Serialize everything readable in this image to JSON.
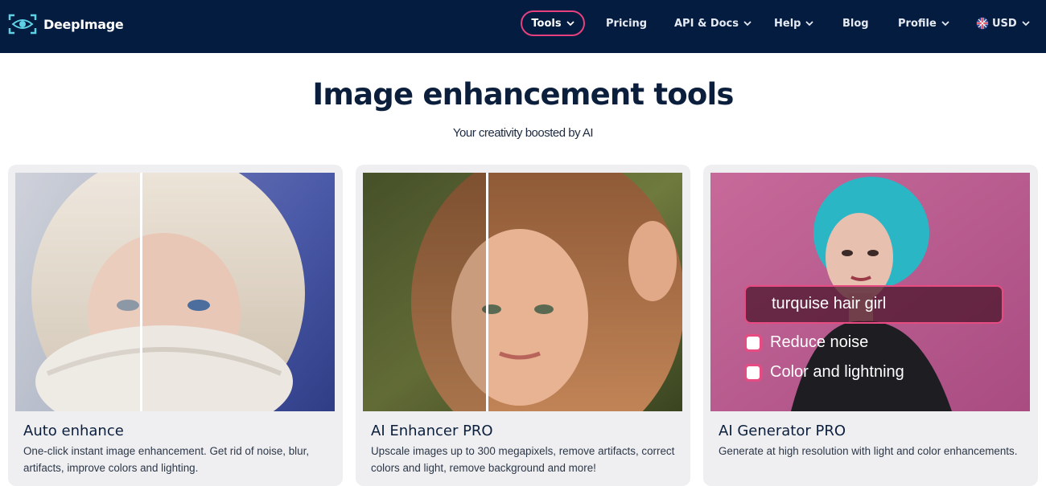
{
  "brand": {
    "name": "DeepImage",
    "logo_icon": "eye-logo-icon"
  },
  "nav": {
    "tools": "Tools",
    "pricing": "Pricing",
    "api_docs": "API & Docs",
    "help": "Help",
    "blog": "Blog",
    "profile": "Profile",
    "currency": "USD",
    "currency_icon": "uk-flag-icon"
  },
  "hero": {
    "title": "Image enhancement tools",
    "subtitle": "Your creativity boosted by AI"
  },
  "cards": [
    {
      "title": "Auto enhance",
      "description": "One-click instant image enhancement. Get rid of noise, blur, artifacts, improve colors and lighting."
    },
    {
      "title": "AI Enhancer PRO",
      "description": "Upscale images up to 300 megapixels, remove artifacts, correct colors and light, remove background and more!"
    },
    {
      "title": "AI Generator PRO",
      "description": "Generate at high resolution with light and color enhancements.",
      "prompt": "turquise hair girl",
      "options": [
        "Reduce noise",
        "Color and lightning"
      ]
    }
  ],
  "colors": {
    "nav_bg": "#041c3f",
    "accent": "#e6407f",
    "text_dark": "#0b1f3c",
    "card_bg": "#efeff1"
  }
}
